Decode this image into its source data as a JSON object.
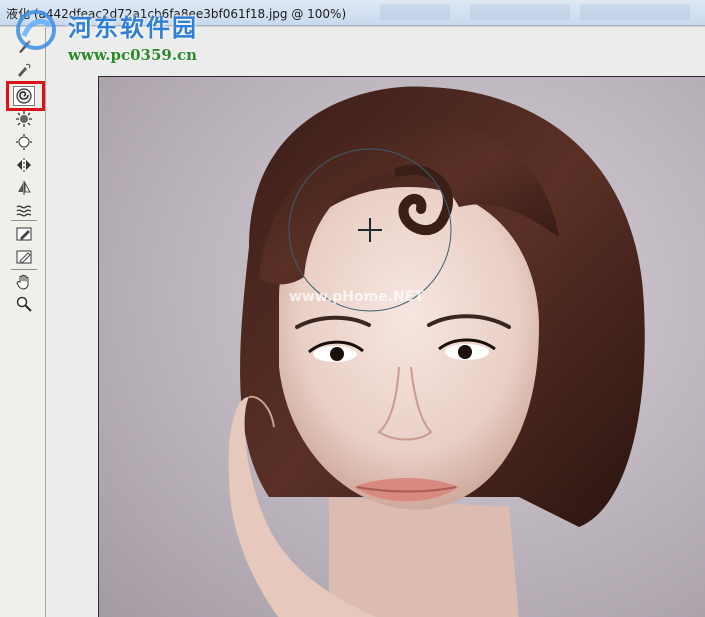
{
  "window": {
    "title": "液化 (a442dfeac2d72a1cb6fa8ee3bf061f18.jpg @ 100%)"
  },
  "watermark": {
    "brand": "河东软件园",
    "url": "www.pc0359.cn"
  },
  "toolbar": {
    "tools": [
      {
        "name": "forward-warp-tool",
        "icon": "finger-brush-icon"
      },
      {
        "name": "reconstruct-tool",
        "icon": "brush-reconstruct-icon"
      },
      {
        "name": "twirl-clockwise-tool",
        "icon": "twirl-icon",
        "selected": true
      },
      {
        "name": "pucker-tool",
        "icon": "pucker-icon"
      },
      {
        "name": "bloat-tool",
        "icon": "bloat-icon"
      },
      {
        "name": "push-left-tool",
        "icon": "push-left-icon"
      },
      {
        "name": "mirror-tool",
        "icon": "mirror-icon"
      },
      {
        "name": "turbulence-tool",
        "icon": "turbulence-icon"
      },
      {
        "name": "freeze-mask-tool",
        "icon": "freeze-mask-icon"
      },
      {
        "name": "thaw-mask-tool",
        "icon": "thaw-mask-icon"
      },
      {
        "name": "hand-tool",
        "icon": "hand-icon"
      },
      {
        "name": "zoom-tool",
        "icon": "zoom-icon"
      }
    ],
    "highlight_color": "#e0101b"
  },
  "canvas": {
    "photo_watermark": "www.pHome.NET",
    "brush_cursor": "crosshair-circle"
  }
}
